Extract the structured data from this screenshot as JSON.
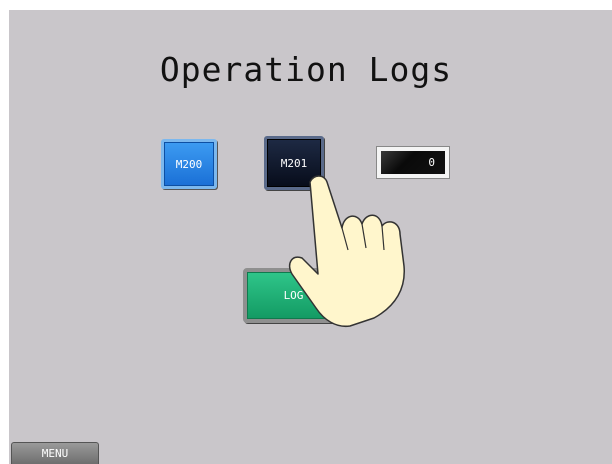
{
  "screen": {
    "title": "Operation Logs",
    "buttons": {
      "m200": "M200",
      "m201": "M201",
      "log": "LOG",
      "menu": "MENU"
    },
    "display": {
      "value": "0"
    }
  },
  "colors": {
    "background": "#c9c6ca",
    "m200": "#1f7ee0",
    "m201": "#0b1226",
    "log": "#1fb07a",
    "menu": "#808080"
  },
  "icons": {
    "pointer": "pointing-hand-icon"
  }
}
